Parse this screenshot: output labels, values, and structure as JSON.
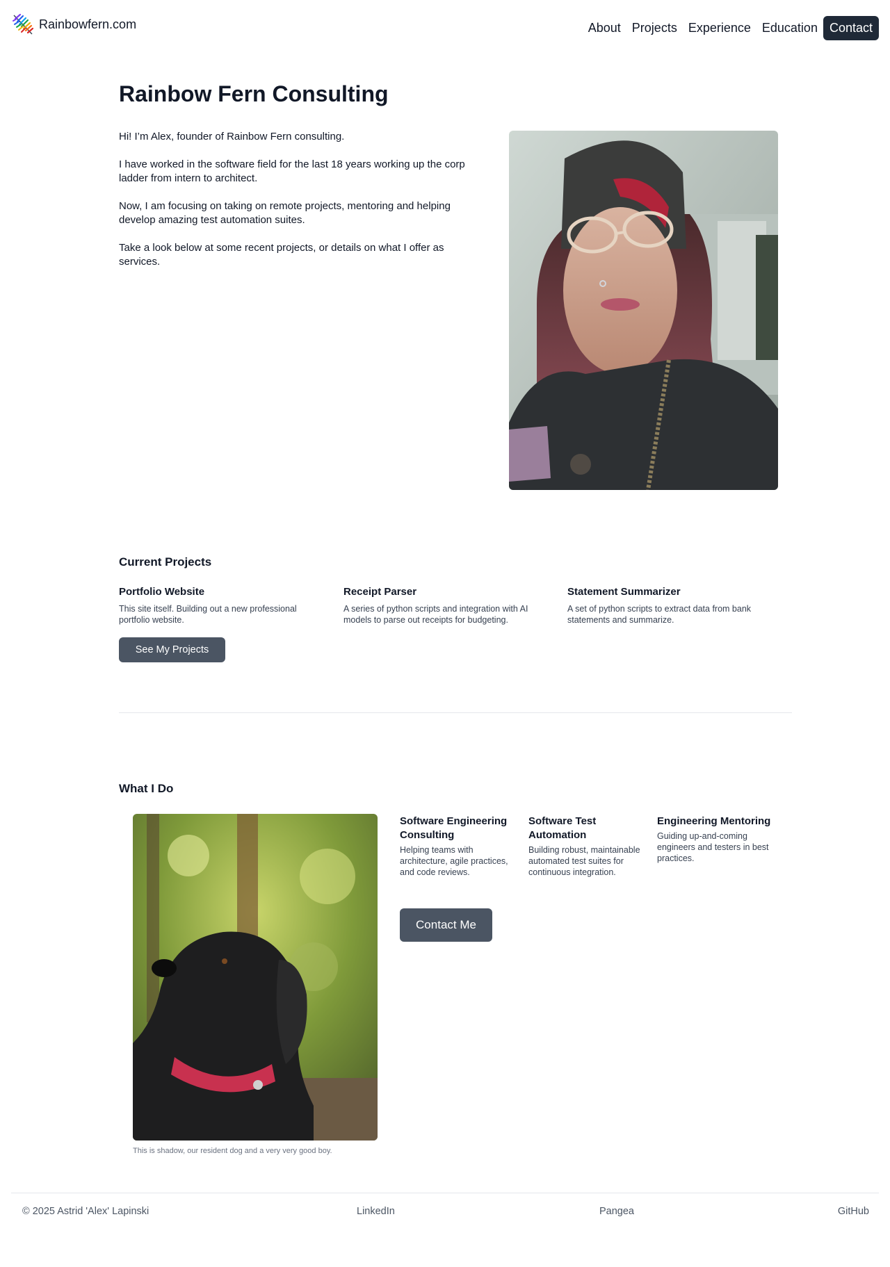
{
  "header": {
    "brand": "Rainbowfern.com",
    "logo_icon": "rainbow-fern-leaf-icon",
    "nav": [
      {
        "label": "About"
      },
      {
        "label": "Projects"
      },
      {
        "label": "Experience"
      },
      {
        "label": "Education"
      },
      {
        "label": "Contact"
      }
    ]
  },
  "hero": {
    "title": "Rainbow Fern Consulting",
    "paragraphs": [
      "Hi! I’m Alex, founder of Rainbow Fern consulting.",
      "I have worked in the software field for the last 18 years working up the corp ladder from intern to architect.",
      "Now, I am focusing on taking on remote projects, mentoring and helping develop amazing test automation suites.",
      "Take a look below at some recent projects, or details on what I offer as services."
    ]
  },
  "projects": {
    "title": "Current Projects",
    "items": [
      {
        "title": "Portfolio Website",
        "description": "This site itself. Building out a new professional portfolio website."
      },
      {
        "title": "Receipt Parser",
        "description": "A series of python scripts and integration with AI models to parse out receipts for budgeting."
      },
      {
        "title": "Statement Summarizer",
        "description": "A set of python scripts to extract data from bank statements and summarize."
      }
    ],
    "button": "See My Projects"
  },
  "services": {
    "title": "What I Do",
    "caption": "This is shadow, our resident dog and a very very good boy.",
    "items": [
      {
        "title": "Software Engineering Consulting",
        "description": "Helping teams with architecture, agile practices, and code reviews."
      },
      {
        "title": "Software Test Automation",
        "description": "Building robust, maintainable automated test suites for continuous integration."
      },
      {
        "title": "Engineering Mentoring",
        "description": "Guiding up-and-coming engineers and testers in best practices."
      }
    ],
    "button": "Contact Me"
  },
  "footer": {
    "copyright": "© 2025 Astrid 'Alex' Lapinski",
    "links": [
      {
        "label": "LinkedIn"
      },
      {
        "label": "Pangea"
      },
      {
        "label": "GitHub"
      }
    ]
  },
  "colors": {
    "dark": "#1f2937",
    "button": "#4b5563",
    "muted_text": "#374151",
    "divider": "#e5e7eb"
  }
}
